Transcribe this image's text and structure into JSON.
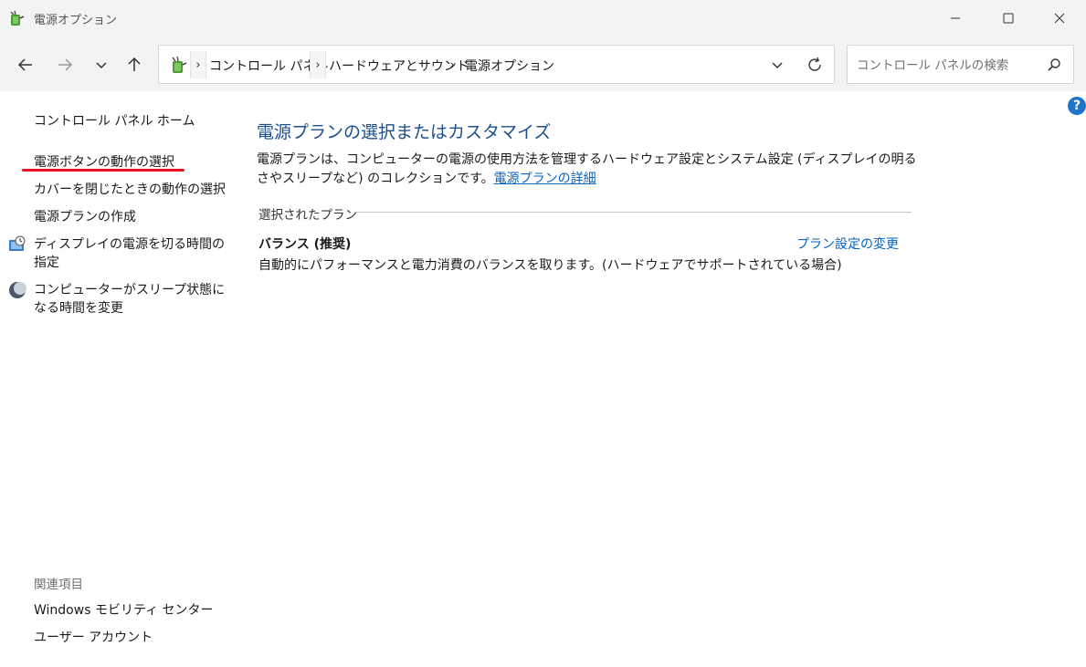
{
  "window": {
    "title": "電源オプション"
  },
  "breadcrumb": {
    "items": [
      "コントロール パネル",
      "ハードウェアとサウンド",
      "電源オプション"
    ],
    "separator": "›"
  },
  "search": {
    "placeholder": "コントロール パネルの検索"
  },
  "sidebar": {
    "links": [
      "コントロール パネル ホーム",
      "電源ボタンの動作の選択",
      "カバーを閉じたときの動作の選択",
      "電源プランの作成",
      "ディスプレイの電源を切る時間の指定",
      "コンピューターがスリープ状態になる時間を変更"
    ],
    "related_label": "関連項目",
    "related_links": [
      "Windows モビリティ センター",
      "ユーザー アカウント"
    ]
  },
  "main": {
    "title": "電源プランの選択またはカスタマイズ",
    "description": "電源プランは、コンピューターの電源の使用方法を管理するハードウェア設定とシステム設定 (ディスプレイの明るさやスリープなど) のコレクションです。",
    "details_link": "電源プランの詳細",
    "selected_plan_label": "選択されたプラン",
    "plan": {
      "name": "バランス (推奨)",
      "description": "自動的にパフォーマンスと電力消費のバランスを取ります。(ハードウェアでサポートされている場合)",
      "change_link": "プラン設定の変更"
    }
  },
  "help": {
    "symbol": "?"
  },
  "colors": {
    "accent_title": "#1c4f8e",
    "link": "#0563c1",
    "red_underline": "#e81123",
    "help_blue": "#1e74c8"
  }
}
